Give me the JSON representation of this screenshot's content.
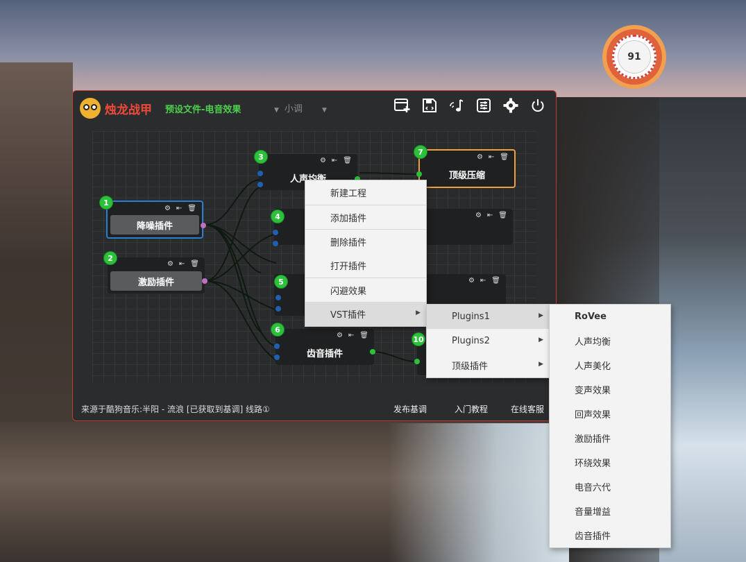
{
  "badge": {
    "value": "91"
  },
  "app": {
    "name": "烛龙战甲",
    "preset": "预设文件-电音效果",
    "key": "小调"
  },
  "toolbar": {
    "icons": [
      "new-project-icon",
      "save-icon",
      "music-note-icon",
      "mixer-icon",
      "settings-gear-icon",
      "power-icon"
    ]
  },
  "nodes": [
    {
      "num": "1",
      "label": "降噪插件"
    },
    {
      "num": "2",
      "label": "激励插件"
    },
    {
      "num": "3",
      "label": "人声均衡"
    },
    {
      "num": "4",
      "label": ""
    },
    {
      "num": "5",
      "label": ""
    },
    {
      "num": "6",
      "label": "齿音插件"
    },
    {
      "num": "7",
      "label": "顶级压缩"
    },
    {
      "num": "10",
      "label": ""
    }
  ],
  "footer": {
    "source": "来源于酷狗音乐:半阳 - 流浪 [已获取到基调] 线路①",
    "publish": "发布基调",
    "tutorial": "入门教程",
    "support": "在线客服"
  },
  "context_menu": {
    "items": [
      "新建工程",
      "添加插件",
      "删除插件",
      "打开插件",
      "闪避效果",
      "VST插件"
    ]
  },
  "submenu_vst": {
    "items": [
      "Plugins1",
      "Plugins2",
      "顶级插件"
    ]
  },
  "submenu_plugins1": {
    "items": [
      "RoVee",
      "人声均衡",
      "人声美化",
      "变声效果",
      "回声效果",
      "激励插件",
      "环绕效果",
      "电音六代",
      "音量增益",
      "齿音插件"
    ]
  },
  "colors": {
    "accent_red": "#ef4a3a",
    "preset_green": "#4cd04c",
    "node_num_green": "#2cc13a",
    "selected_blue": "#2b7fd0",
    "selected_orange": "#f0a040"
  }
}
